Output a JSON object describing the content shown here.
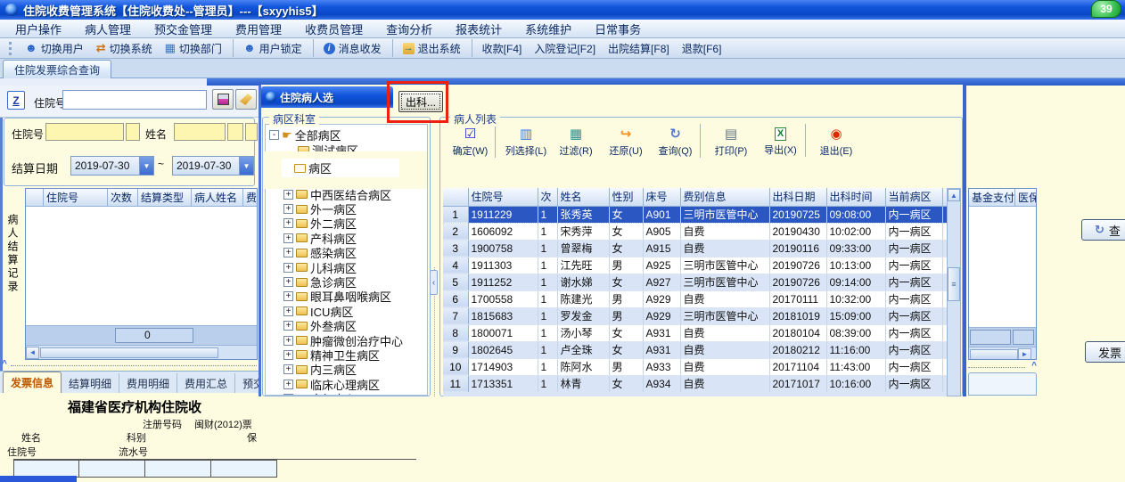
{
  "window": {
    "title": "住院收费管理系统【住院收费处--管理员】---【sxyyhis5】",
    "badge": "39"
  },
  "menu": {
    "items": [
      "用户操作",
      "病人管理",
      "预交金管理",
      "费用管理",
      "收费员管理",
      "查询分析",
      "报表统计",
      "系统维护",
      "日常事务"
    ]
  },
  "toolbar": {
    "items": [
      {
        "glyph": "☻",
        "icon": "switch-user-icon",
        "label": "切换用户"
      },
      {
        "glyph": "⇄",
        "icon": "switch-system-icon",
        "label": "切换系统"
      },
      {
        "glyph": "▦",
        "icon": "switch-department-icon",
        "label": "切换部门",
        "cls": "sep-after"
      },
      {
        "glyph": "☻",
        "icon": "user-lock-icon",
        "label": "用户锁定",
        "cls": "sep-after"
      },
      {
        "glyph": "i",
        "icon": "message-icon",
        "label": "消息收发",
        "cls": "sep-after"
      },
      {
        "glyph": "→",
        "icon": "exit-system-icon",
        "label": "退出系统",
        "cls": "sep-after"
      },
      {
        "glyph": "",
        "icon": "",
        "label": "收款[F4]"
      },
      {
        "glyph": "",
        "icon": "",
        "label": "入院登记[F2]"
      },
      {
        "glyph": "",
        "icon": "",
        "label": "出院结算[F8]"
      },
      {
        "glyph": "",
        "icon": "",
        "label": "退款[F6]"
      }
    ]
  },
  "tabs": {
    "active": "住院发票综合查询"
  },
  "quick_search": {
    "z_label": "Z",
    "label": "住院号"
  },
  "filter": {
    "inpatient_label": "住院号",
    "name_label": "姓名",
    "date_label": "结算日期",
    "date_from": "2019-07-30",
    "tilde": "~",
    "date_to": "2019-07-30"
  },
  "record_panel": {
    "vertical_label": "病人结算记录",
    "columns": [
      "",
      "住院号",
      "次数",
      "结算类型",
      "病人姓名",
      "费"
    ],
    "footer_value": "0"
  },
  "bottom_tabs": {
    "items": [
      {
        "label": "发票信息",
        "cls": "active"
      },
      {
        "label": "结算明细"
      },
      {
        "label": "费用明细"
      },
      {
        "label": "费用汇总"
      },
      {
        "label": "预交金"
      }
    ]
  },
  "invoice": {
    "title": "福建省医疗机构住院收",
    "reg_label": "注册号码",
    "reg_value": "闽财(2012)票",
    "name_label": "姓名",
    "dept_label": "科别",
    "insurance_label": "保",
    "inpatient_label": "住院号",
    "serial_label": "流水号"
  },
  "patient_window": {
    "title": "住院病人选",
    "out_dept_button": "出科...",
    "ward_group": "病区科室",
    "list_group": "病人列表",
    "tree_top": [
      {
        "exp": "-",
        "glyph": "☛",
        "icon": "hand-pointer-icon",
        "label": "全部病区"
      },
      {
        "exp": "",
        "glyph": "",
        "icon": "folder-icon",
        "label": "测试病区",
        "cls": "ind1"
      }
    ],
    "tree_patch": {
      "label": "病区"
    },
    "tree": [
      {
        "exp": "+",
        "icon": "folder-icon",
        "label": "中西医结合病区"
      },
      {
        "exp": "+",
        "icon": "folder-icon",
        "label": "外一病区"
      },
      {
        "exp": "+",
        "icon": "folder-icon",
        "label": "外二病区"
      },
      {
        "exp": "+",
        "icon": "folder-icon",
        "label": "产科病区"
      },
      {
        "exp": "+",
        "icon": "folder-icon",
        "label": "感染病区"
      },
      {
        "exp": "+",
        "icon": "folder-icon",
        "label": "儿科病区"
      },
      {
        "exp": "+",
        "icon": "folder-icon",
        "label": "急诊病区"
      },
      {
        "exp": "+",
        "icon": "folder-icon",
        "label": "眼耳鼻咽喉病区"
      },
      {
        "exp": "+",
        "icon": "folder-icon",
        "label": "ICU病区"
      },
      {
        "exp": "+",
        "icon": "folder-icon",
        "label": "外叁病区"
      },
      {
        "exp": "+",
        "icon": "folder-icon",
        "label": "肿瘤微创治疗中心"
      },
      {
        "exp": "+",
        "icon": "folder-icon",
        "label": "精神卫生病区"
      },
      {
        "exp": "+",
        "icon": "folder-icon",
        "label": "内三病区"
      },
      {
        "exp": "+",
        "icon": "folder-icon",
        "label": "临床心理病区"
      },
      {
        "exp": "+",
        "icon": "folder-icon",
        "label": "康复中心"
      }
    ],
    "list_toolbar": [
      {
        "glyph": "☑",
        "icon": "confirm-icon",
        "label": "确定(W)",
        "cls": "sep-after"
      },
      {
        "glyph": "▥",
        "icon": "column-select-icon",
        "label": "列选择(L)"
      },
      {
        "glyph": "▦",
        "icon": "filter-icon",
        "label": "过滤(R)"
      },
      {
        "glyph": "↪",
        "icon": "restore-icon",
        "label": "还原(U)"
      },
      {
        "glyph": "↻",
        "icon": "query-icon",
        "label": "查询(Q)",
        "cls": "sep-after"
      },
      {
        "glyph": "▤",
        "icon": "print-icon",
        "label": "打印(P)"
      },
      {
        "glyph": "X",
        "icon": "export-excel-icon",
        "label": "导出(X)",
        "cls": "sep-after"
      },
      {
        "glyph": "◉",
        "icon": "exit-icon",
        "label": "退出(E)"
      }
    ],
    "table": {
      "columns": [
        "",
        "住院号",
        "次",
        "姓名",
        "性别",
        "床号",
        "费别信息",
        "出科日期",
        "出科时间",
        "当前病区",
        ""
      ],
      "rows": [
        {
          "num": "1",
          "cls": "sel",
          "cells": [
            "1911229",
            "1",
            "张秀英",
            "女",
            "A901",
            "三明市医管中心",
            "20190725",
            "09:08:00",
            "内一病区"
          ]
        },
        {
          "num": "2",
          "cells": [
            "1606092",
            "1",
            "宋秀萍",
            "女",
            "A905",
            "自费",
            "20190430",
            "10:02:00",
            "内一病区"
          ]
        },
        {
          "num": "3",
          "cells": [
            "1900758",
            "1",
            "曾翠梅",
            "女",
            "A915",
            "自费",
            "20190116",
            "09:33:00",
            "内一病区"
          ]
        },
        {
          "num": "4",
          "cells": [
            "1911303",
            "1",
            "江先旺",
            "男",
            "A925",
            "三明市医管中心",
            "20190726",
            "10:13:00",
            "内一病区"
          ]
        },
        {
          "num": "5",
          "cells": [
            "1911252",
            "1",
            "谢水娣",
            "女",
            "A927",
            "三明市医管中心",
            "20190726",
            "09:14:00",
            "内一病区"
          ]
        },
        {
          "num": "6",
          "cells": [
            "1700558",
            "1",
            "陈建光",
            "男",
            "A929",
            "自费",
            "20170111",
            "10:32:00",
            "内一病区"
          ]
        },
        {
          "num": "7",
          "cells": [
            "1815683",
            "1",
            "罗发金",
            "男",
            "A929",
            "三明市医管中心",
            "20181019",
            "15:09:00",
            "内一病区"
          ]
        },
        {
          "num": "8",
          "cells": [
            "1800071",
            "1",
            "汤小琴",
            "女",
            "A931",
            "自费",
            "20180104",
            "08:39:00",
            "内一病区"
          ]
        },
        {
          "num": "9",
          "cells": [
            "1802645",
            "1",
            "卢全珠",
            "女",
            "A931",
            "自费",
            "20180212",
            "11:16:00",
            "内一病区"
          ]
        },
        {
          "num": "10",
          "cells": [
            "1714903",
            "1",
            "陈阿水",
            "男",
            "A933",
            "自费",
            "20171104",
            "11:43:00",
            "内一病区"
          ]
        },
        {
          "num": "11",
          "cells": [
            "1713351",
            "1",
            "林青",
            "女",
            "A934",
            "自费",
            "20171017",
            "10:16:00",
            "内一病区"
          ]
        }
      ]
    }
  },
  "fund_panel": {
    "columns": [
      "基金支付",
      "医保"
    ]
  },
  "right_buttons": {
    "query": "查",
    "invoice": "发票"
  }
}
